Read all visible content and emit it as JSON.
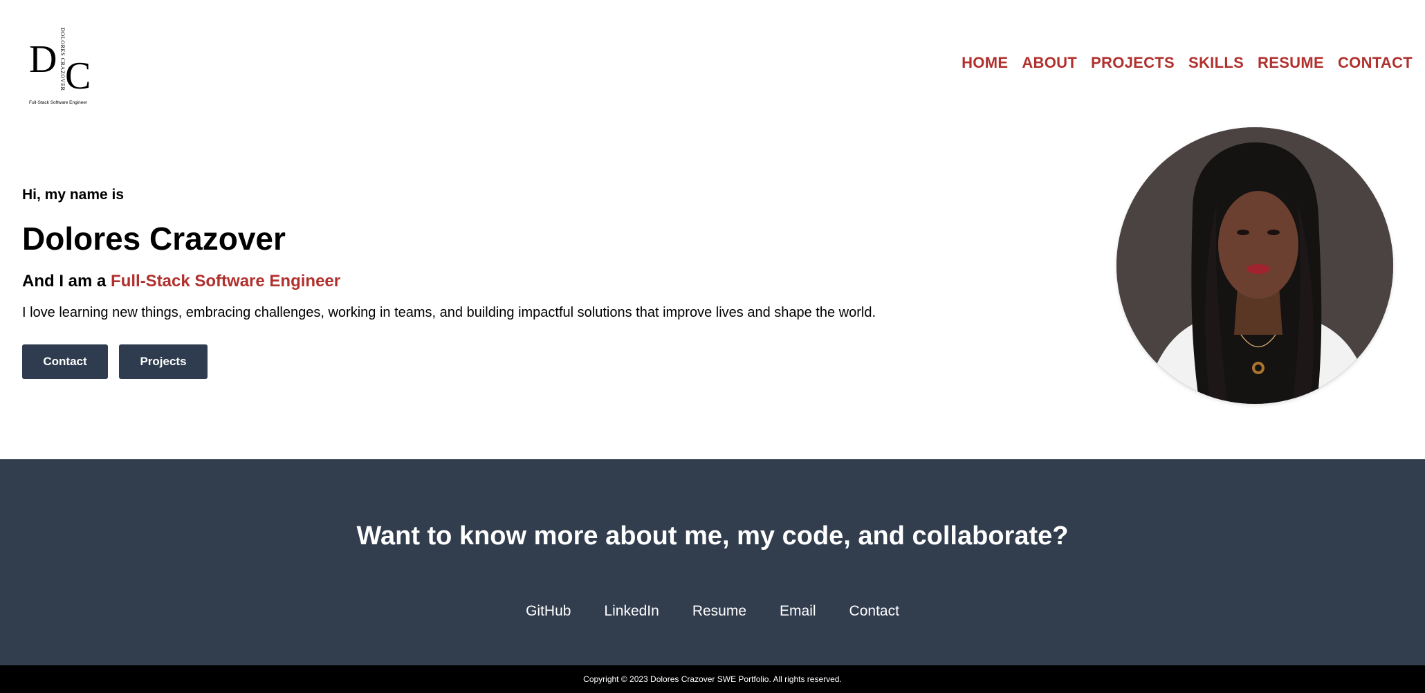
{
  "logo": {
    "monogram_left": "D",
    "monogram_right": "C",
    "vertical_text": "DOLORES CRAZOVER",
    "tagline": "Full-Stack Software Engineer"
  },
  "nav": {
    "items": [
      {
        "label": "HOME"
      },
      {
        "label": "ABOUT"
      },
      {
        "label": "PROJECTS"
      },
      {
        "label": "SKILLS"
      },
      {
        "label": "RESUME"
      },
      {
        "label": "CONTACT"
      }
    ]
  },
  "hero": {
    "greeting": "Hi, my name is",
    "name": "Dolores Crazover",
    "role_prefix": "And I am a ",
    "role_highlight": "Full-Stack Software Engineer",
    "description": "I love learning new things, embracing challenges, working in teams, and building impactful solutions that improve lives and shape the world.",
    "buttons": {
      "contact": "Contact",
      "projects": "Projects"
    }
  },
  "cta": {
    "title": "Want to know more about me, my code, and collaborate?",
    "links": [
      "GitHub",
      "LinkedIn",
      "Resume",
      "Email",
      "Contact"
    ]
  },
  "footer": {
    "copyright": "Copyright © 2023 Dolores Crazover SWE Portfolio. All rights reserved."
  },
  "colors": {
    "accent": "#b0302d",
    "navy": "#323d4e",
    "button": "#2f3c4f",
    "footer_bg": "#000000"
  }
}
